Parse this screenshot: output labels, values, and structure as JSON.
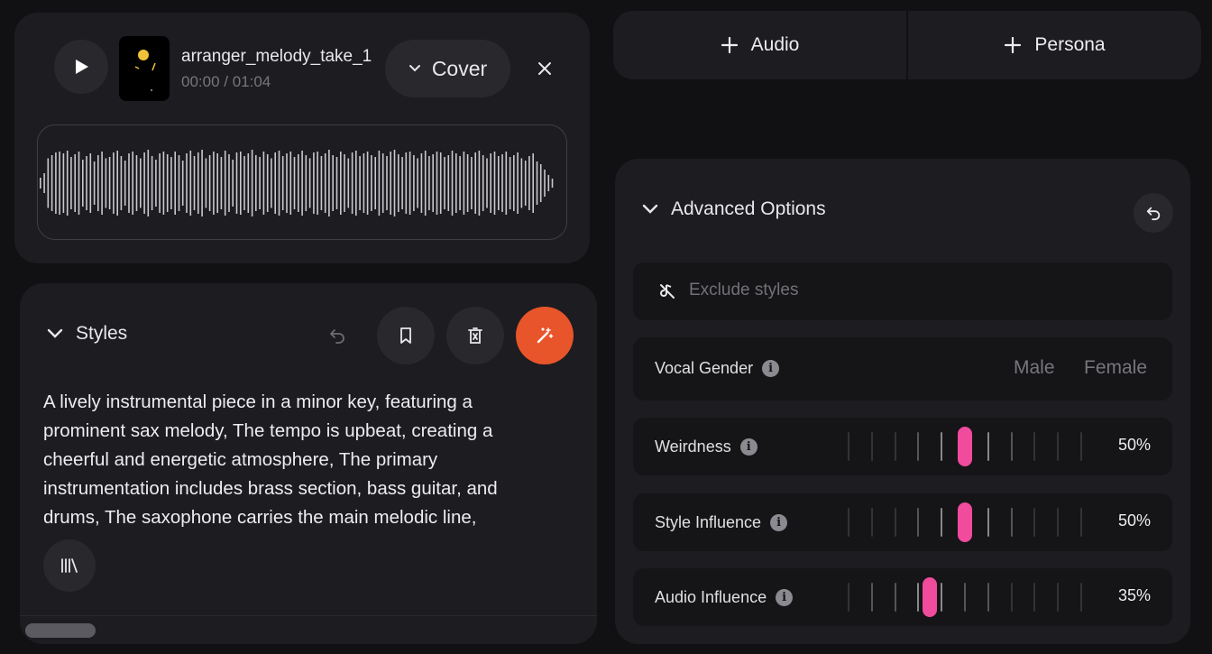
{
  "player": {
    "track_title": "arranger_melody_take_1",
    "time": "00:00 / 01:04",
    "mode_label": "Cover",
    "waveform": [
      0.12,
      0.22,
      0.55,
      0.62,
      0.68,
      0.7,
      0.66,
      0.72,
      0.58,
      0.64,
      0.7,
      0.52,
      0.6,
      0.66,
      0.48,
      0.62,
      0.7,
      0.55,
      0.58,
      0.68,
      0.72,
      0.6,
      0.5,
      0.66,
      0.7,
      0.62,
      0.55,
      0.68,
      0.74,
      0.6,
      0.52,
      0.66,
      0.7,
      0.64,
      0.58,
      0.7,
      0.62,
      0.5,
      0.66,
      0.72,
      0.6,
      0.68,
      0.74,
      0.55,
      0.62,
      0.7,
      0.66,
      0.58,
      0.72,
      0.64,
      0.52,
      0.68,
      0.7,
      0.6,
      0.66,
      0.74,
      0.62,
      0.58,
      0.7,
      0.64,
      0.55,
      0.68,
      0.72,
      0.6,
      0.66,
      0.7,
      0.58,
      0.64,
      0.72,
      0.62,
      0.55,
      0.68,
      0.7,
      0.6,
      0.66,
      0.74,
      0.62,
      0.58,
      0.7,
      0.64,
      0.55,
      0.68,
      0.72,
      0.6,
      0.66,
      0.7,
      0.62,
      0.58,
      0.72,
      0.66,
      0.6,
      0.7,
      0.74,
      0.64,
      0.58,
      0.68,
      0.7,
      0.62,
      0.55,
      0.66,
      0.72,
      0.6,
      0.64,
      0.7,
      0.68,
      0.58,
      0.62,
      0.72,
      0.66,
      0.6,
      0.7,
      0.64,
      0.58,
      0.68,
      0.72,
      0.62,
      0.55,
      0.66,
      0.7,
      0.6,
      0.64,
      0.7,
      0.58,
      0.62,
      0.68,
      0.55,
      0.5,
      0.6,
      0.66,
      0.48,
      0.42,
      0.3,
      0.18,
      0.1
    ]
  },
  "styles": {
    "title": "Styles",
    "text": "A lively instrumental piece in a minor key, featuring a prominent sax melody, The tempo is upbeat, creating a cheerful and energetic atmosphere, The primary instrumentation includes brass section, bass guitar, and drums, The saxophone carries the main melodic line,"
  },
  "top_buttons": {
    "audio_label": "Audio",
    "persona_label": "Persona"
  },
  "advanced": {
    "title": "Advanced Options",
    "exclude_placeholder": "Exclude styles",
    "vocal_gender": {
      "label": "Vocal Gender",
      "options": [
        "Male",
        "Female"
      ]
    },
    "sliders": [
      {
        "label": "Weirdness",
        "value": 0.5,
        "display": "50%"
      },
      {
        "label": "Style Influence",
        "value": 0.5,
        "display": "50%"
      },
      {
        "label": "Audio Influence",
        "value": 0.35,
        "display": "35%"
      }
    ]
  },
  "colors": {
    "accent_orange": "#e8552b",
    "slider_pink": "#f04b9c",
    "panel": "#1d1c20",
    "background": "#111113"
  }
}
